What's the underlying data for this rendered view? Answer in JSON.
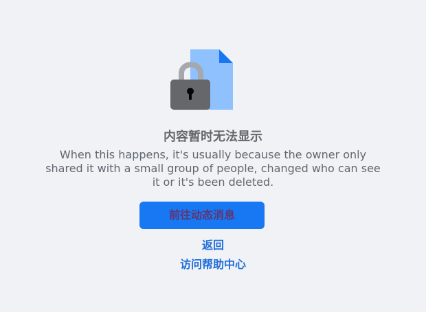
{
  "content": {
    "icon": "locked-document-icon",
    "title": "内容暂时无法显示",
    "message": "When this happens, it's usually because the owner only shared it with a small group of people, changed who can see it or it's been deleted."
  },
  "actions": {
    "primary_label": "前往动态消息",
    "back_label": "返回",
    "help_label": "访问帮助中心"
  },
  "colors": {
    "background": "#f0f2f5",
    "primary_button": "#1877f2",
    "link": "#216fdb",
    "title_text": "#65676b",
    "document_fill": "#8fc1ff",
    "document_fold": "#1877f2",
    "lock_body": "#65676b",
    "lock_shackle": "#a5a8ad"
  }
}
